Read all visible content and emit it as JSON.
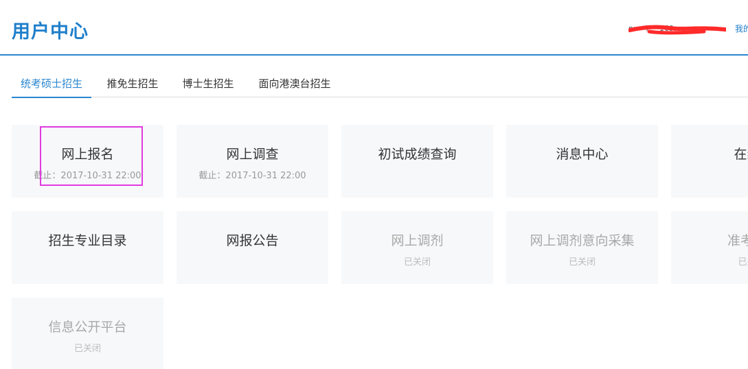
{
  "header": {
    "title": "用户中心",
    "user_name": "nı  ·  ·7·  ·  169.com",
    "user_link": "我的"
  },
  "tabs": [
    {
      "label": "统考硕士招生",
      "active": true
    },
    {
      "label": "推免生招生",
      "active": false
    },
    {
      "label": "博士生招生",
      "active": false
    },
    {
      "label": "面向港澳台招生",
      "active": false
    }
  ],
  "cards": [
    {
      "title": "网上报名",
      "subtitle": "截止：2017-10-31 22:00",
      "disabled": false
    },
    {
      "title": "网上调查",
      "subtitle": "截止：2017-10-31 22:00",
      "disabled": false
    },
    {
      "title": "初试成绩查询",
      "subtitle": "",
      "disabled": false
    },
    {
      "title": "消息中心",
      "subtitle": "",
      "disabled": false
    },
    {
      "title": "在线",
      "subtitle": "",
      "disabled": false
    },
    {
      "title": "招生专业目录",
      "subtitle": "",
      "disabled": false
    },
    {
      "title": "网报公告",
      "subtitle": "",
      "disabled": false
    },
    {
      "title": "网上调剂",
      "subtitle": "已关闭",
      "disabled": true
    },
    {
      "title": "网上调剂意向采集",
      "subtitle": "已关闭",
      "disabled": true
    },
    {
      "title": "准考证",
      "subtitle": "已关",
      "disabled": true
    },
    {
      "title": "信息公开平台",
      "subtitle": "已关闭",
      "disabled": true
    }
  ],
  "colors": {
    "accent": "#2a86cf",
    "title_blue": "#1f7fcb",
    "card_bg": "#f7f8fa",
    "highlight": "#e03ae0",
    "redaction": "#ff2a2a"
  }
}
